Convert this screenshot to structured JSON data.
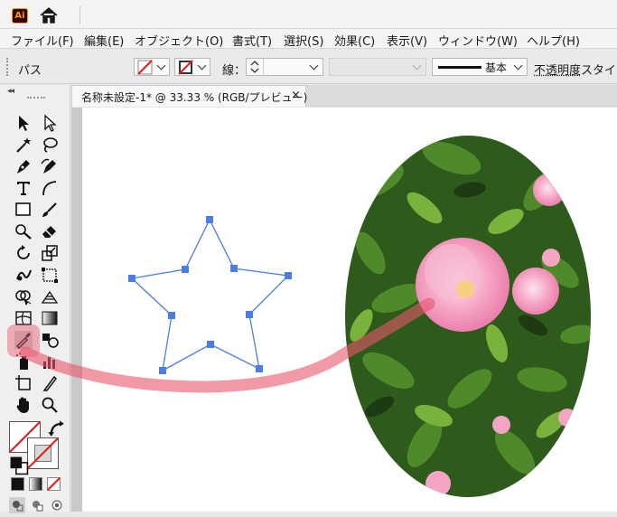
{
  "app": {
    "logo_text": "Ai"
  },
  "menu": {
    "items": [
      {
        "label": "ファイル(F)"
      },
      {
        "label": "編集(E)"
      },
      {
        "label": "オブジェクト(O)"
      },
      {
        "label": "書式(T)"
      },
      {
        "label": "選択(S)"
      },
      {
        "label": "効果(C)"
      },
      {
        "label": "表示(V)"
      },
      {
        "label": "ウィンドウ(W)"
      },
      {
        "label": "ヘルプ(H)"
      }
    ]
  },
  "control_bar": {
    "selection_label": "パス",
    "stroke_label": "線：",
    "stroke_value": "",
    "brush_label": "基本",
    "opacity_label": "不透明度",
    "style_label": "スタイル"
  },
  "document": {
    "tab_title": "名称未設定-1* @ 33.33 % (RGB/プレビュー)",
    "close_symbol": "×"
  },
  "icons": [
    "ai-logo-icon",
    "home-icon",
    "selection-tool-icon",
    "direct-selection-tool-icon",
    "magic-wand-icon",
    "lasso-icon",
    "pen-tool-icon",
    "curvature-icon",
    "type-tool-icon",
    "arc-icon",
    "rectangle-tool-icon",
    "paintbrush-icon",
    "shaper-icon",
    "eraser-icon",
    "rotate-icon",
    "scale-icon",
    "warp-icon",
    "free-transform-icon",
    "shape-builder-icon",
    "perspective-grid-icon",
    "mesh-icon",
    "gradient-icon",
    "eyedropper-icon",
    "blend-icon",
    "symbol-sprayer-icon",
    "graph-icon",
    "artboard-icon",
    "slice-icon",
    "hand-tool-icon",
    "zoom-tool-icon",
    "swap-fill-stroke-icon",
    "default-colors-icon"
  ],
  "colors": {
    "accent_path": "#4a7de8",
    "highlight": "#e8566a",
    "fill_none_slash": "#e41a1a"
  }
}
